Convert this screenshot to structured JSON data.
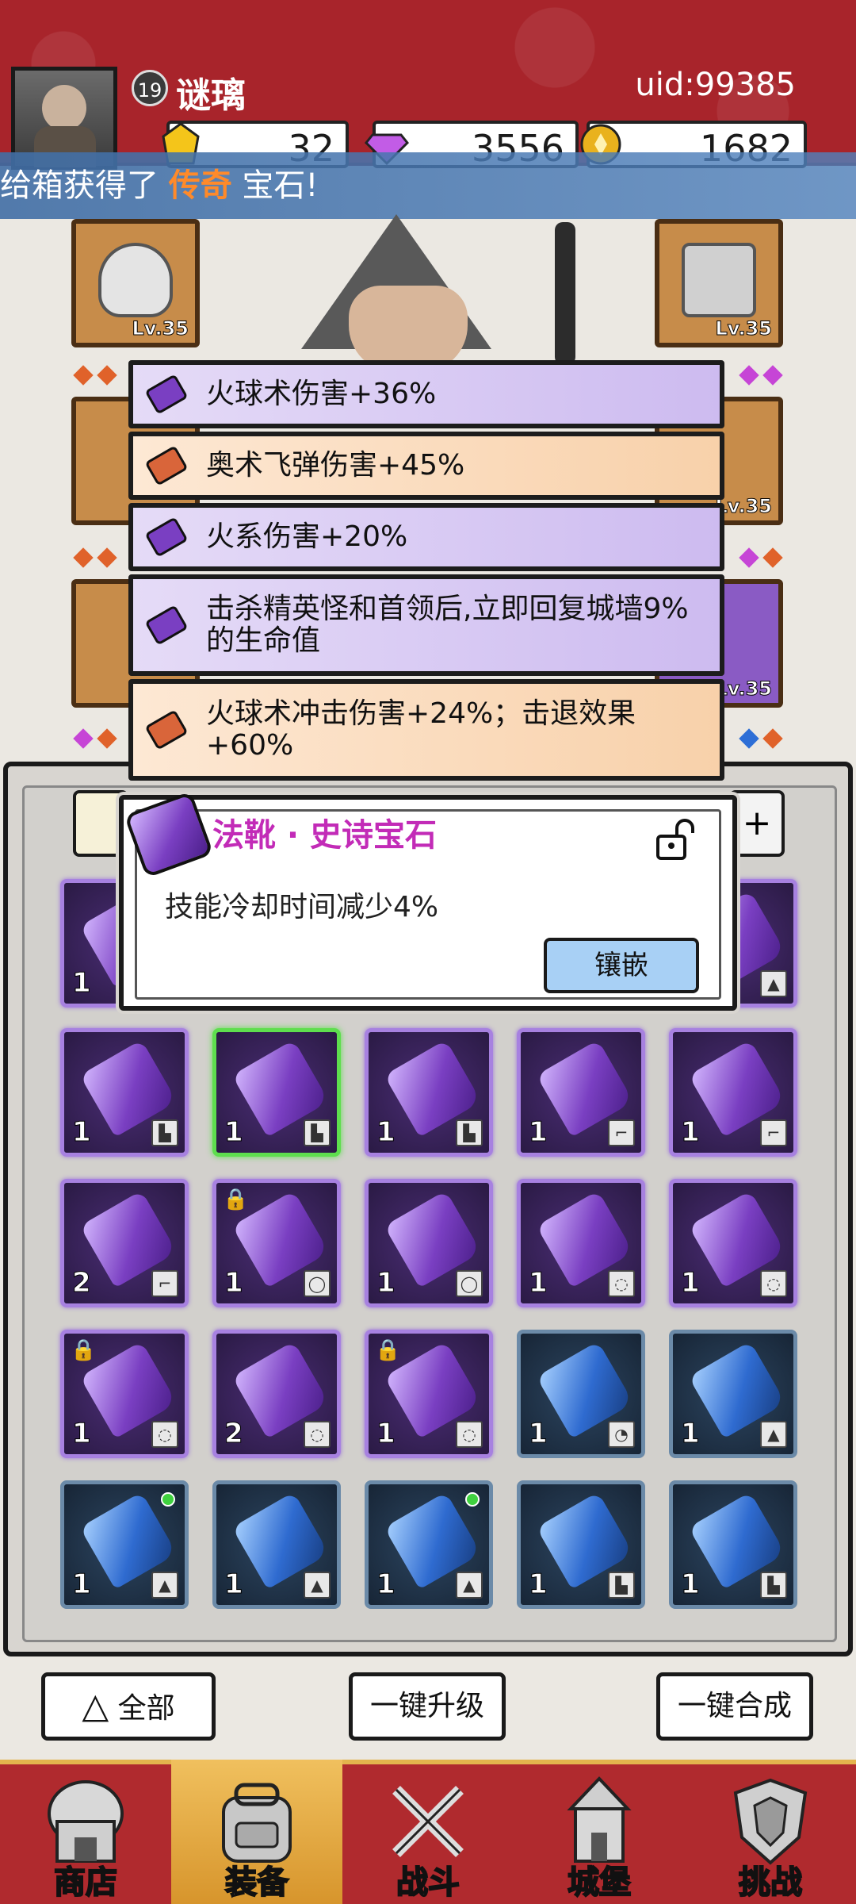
{
  "player": {
    "level": "19",
    "name": "谜璃",
    "uid": "uid:99385"
  },
  "resources": [
    {
      "icon": "gold-crystal-icon",
      "value": "32"
    },
    {
      "icon": "gem-diamond-icon",
      "value": "3556"
    },
    {
      "icon": "coin-icon",
      "value": "1682"
    }
  ],
  "banner": {
    "prefix": "给箱获得了 ",
    "highlight": "传奇",
    "suffix": " 宝石!"
  },
  "equipment_slots": [
    {
      "level": "Lv.35"
    },
    {
      "level": "Lv.35"
    },
    {
      "level": "Lv.35"
    },
    {
      "level": "Lv.35"
    }
  ],
  "affixes": [
    {
      "color": "purple",
      "text": "火球术伤害+36%"
    },
    {
      "color": "orange",
      "text": "奥术飞弹伤害+45%"
    },
    {
      "color": "purple",
      "text": "火系伤害+20%"
    },
    {
      "color": "purple",
      "text": "击杀精英怪和首领后,立即回复城墙9%的生命值"
    },
    {
      "color": "orange",
      "text": "火球术冲击伤害+24%；击退效果+60%"
    }
  ],
  "popup": {
    "title": "法靴 · 史诗宝石",
    "description": "技能冷却时间减少4%",
    "inlay_button": "镶嵌"
  },
  "inventory_rows": [
    [
      {
        "type": "purple",
        "count": "1",
        "slot_icon": "boot",
        "locked": false,
        "new": false,
        "selected": false
      },
      {
        "type": "purple",
        "count": "1",
        "slot_icon": "boot",
        "locked": false,
        "new": false,
        "selected": true
      },
      {
        "type": "purple",
        "count": "1",
        "slot_icon": "boot",
        "locked": false,
        "new": false,
        "selected": false
      },
      {
        "type": "purple",
        "count": "1",
        "slot_icon": "wand",
        "locked": false,
        "new": false,
        "selected": false
      },
      {
        "type": "purple",
        "count": "1",
        "slot_icon": "wand",
        "locked": false,
        "new": false,
        "selected": false
      }
    ],
    [
      {
        "type": "purple",
        "count": "2",
        "slot_icon": "wand",
        "locked": false,
        "new": false,
        "selected": false
      },
      {
        "type": "purple",
        "count": "1",
        "slot_icon": "ring",
        "locked": true,
        "new": false,
        "selected": false
      },
      {
        "type": "purple",
        "count": "1",
        "slot_icon": "ring",
        "locked": false,
        "new": false,
        "selected": false
      },
      {
        "type": "purple",
        "count": "1",
        "slot_icon": "necklace",
        "locked": false,
        "new": false,
        "selected": false
      },
      {
        "type": "purple",
        "count": "1",
        "slot_icon": "necklace",
        "locked": false,
        "new": false,
        "selected": false
      }
    ],
    [
      {
        "type": "purple",
        "count": "1",
        "slot_icon": "necklace",
        "locked": true,
        "new": false,
        "selected": false
      },
      {
        "type": "purple",
        "count": "2",
        "slot_icon": "necklace",
        "locked": false,
        "new": false,
        "selected": false
      },
      {
        "type": "purple",
        "count": "1",
        "slot_icon": "necklace",
        "locked": true,
        "new": false,
        "selected": false
      },
      {
        "type": "blue",
        "count": "1",
        "slot_icon": "hood",
        "locked": false,
        "new": false,
        "selected": false
      },
      {
        "type": "blue",
        "count": "1",
        "slot_icon": "robe",
        "locked": false,
        "new": false,
        "selected": false
      }
    ],
    [
      {
        "type": "blue",
        "count": "1",
        "slot_icon": "robe",
        "locked": false,
        "new": true,
        "selected": false
      },
      {
        "type": "blue",
        "count": "1",
        "slot_icon": "robe",
        "locked": false,
        "new": false,
        "selected": false
      },
      {
        "type": "blue",
        "count": "1",
        "slot_icon": "robe",
        "locked": false,
        "new": true,
        "selected": false
      },
      {
        "type": "blue",
        "count": "1",
        "slot_icon": "boot",
        "locked": false,
        "new": false,
        "selected": false
      },
      {
        "type": "blue",
        "count": "1",
        "slot_icon": "boot",
        "locked": false,
        "new": false,
        "selected": false
      }
    ]
  ],
  "partial_row": [
    {
      "count": "1"
    },
    {
      "count": ""
    }
  ],
  "actions": {
    "all": "全部",
    "upgrade": "一键升级",
    "merge": "一键合成"
  },
  "nav": [
    {
      "label": "商店",
      "icon": "shop-icon",
      "active": false
    },
    {
      "label": "装备",
      "icon": "backpack-icon",
      "active": true
    },
    {
      "label": "战斗",
      "icon": "crossed-swords-icon",
      "active": false
    },
    {
      "label": "城堡",
      "icon": "castle-icon",
      "active": false
    },
    {
      "label": "挑战",
      "icon": "challenge-shield-icon",
      "active": false
    }
  ],
  "colors": {
    "header_red": "#a8242b",
    "epic_purple": "#7a3fc2",
    "rare_blue": "#2f6bd0",
    "title_magenta": "#c22bb7",
    "orange_highlight": "#ff8a2a"
  }
}
